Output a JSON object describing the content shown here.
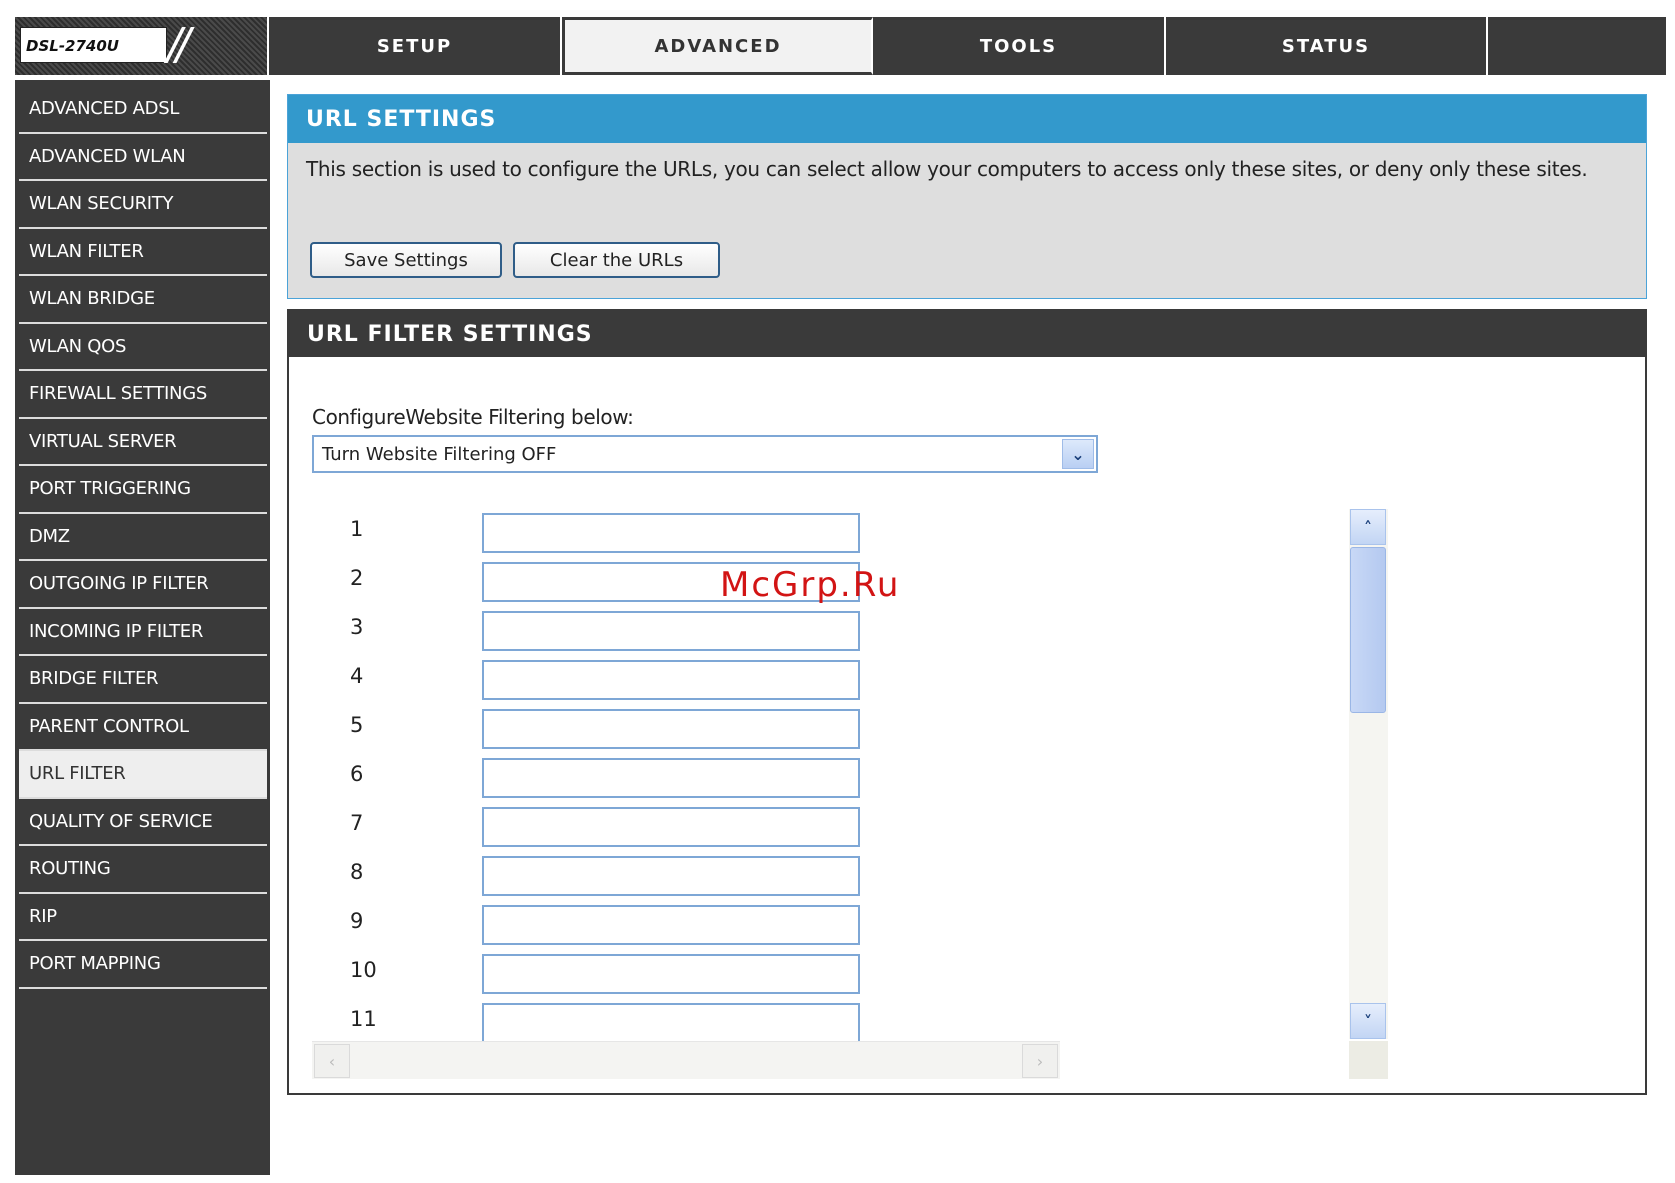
{
  "header": {
    "model": "DSL-2740U",
    "tabs": [
      {
        "label": "SETUP"
      },
      {
        "label": "ADVANCED"
      },
      {
        "label": "TOOLS"
      },
      {
        "label": "STATUS"
      }
    ]
  },
  "sidebar": {
    "items": [
      {
        "label": "ADVANCED ADSL"
      },
      {
        "label": "ADVANCED WLAN"
      },
      {
        "label": "WLAN SECURITY"
      },
      {
        "label": "WLAN FILTER"
      },
      {
        "label": "WLAN BRIDGE"
      },
      {
        "label": "WLAN QOS"
      },
      {
        "label": "FIREWALL SETTINGS"
      },
      {
        "label": "VIRTUAL SERVER"
      },
      {
        "label": "PORT TRIGGERING"
      },
      {
        "label": "DMZ"
      },
      {
        "label": "OUTGOING IP FILTER"
      },
      {
        "label": "INCOMING IP FILTER"
      },
      {
        "label": "BRIDGE FILTER"
      },
      {
        "label": "PARENT CONTROL"
      },
      {
        "label": "URL FILTER"
      },
      {
        "label": "QUALITY OF SERVICE"
      },
      {
        "label": "ROUTING"
      },
      {
        "label": "RIP"
      },
      {
        "label": "PORT MAPPING"
      }
    ]
  },
  "url_settings": {
    "title": "URL SETTINGS",
    "description": "This section is used to configure the URLs, you can select allow your computers to access only these sites, or deny only these sites.",
    "save_label": "Save Settings",
    "clear_label": "Clear the URLs"
  },
  "url_filter": {
    "title": "URL FILTER SETTINGS",
    "configure_label": "ConfigureWebsite Filtering below:",
    "select_value": "Turn Website Filtering OFF",
    "rows": [
      {
        "num": "1",
        "value": ""
      },
      {
        "num": "2",
        "value": ""
      },
      {
        "num": "3",
        "value": ""
      },
      {
        "num": "4",
        "value": ""
      },
      {
        "num": "5",
        "value": ""
      },
      {
        "num": "6",
        "value": ""
      },
      {
        "num": "7",
        "value": ""
      },
      {
        "num": "8",
        "value": ""
      },
      {
        "num": "9",
        "value": ""
      },
      {
        "num": "10",
        "value": ""
      },
      {
        "num": "11",
        "value": ""
      }
    ]
  },
  "watermark": "McGrp.Ru",
  "icons": {
    "up": "chevron-up-icon",
    "down": "chevron-down-icon",
    "left": "chevron-left-icon",
    "right": "chevron-right-icon"
  },
  "colors": {
    "nav_dark": "#3a3a3a",
    "header_blue": "#3399cc",
    "panel_gray": "#dedede",
    "watermark_red": "#d21414"
  }
}
